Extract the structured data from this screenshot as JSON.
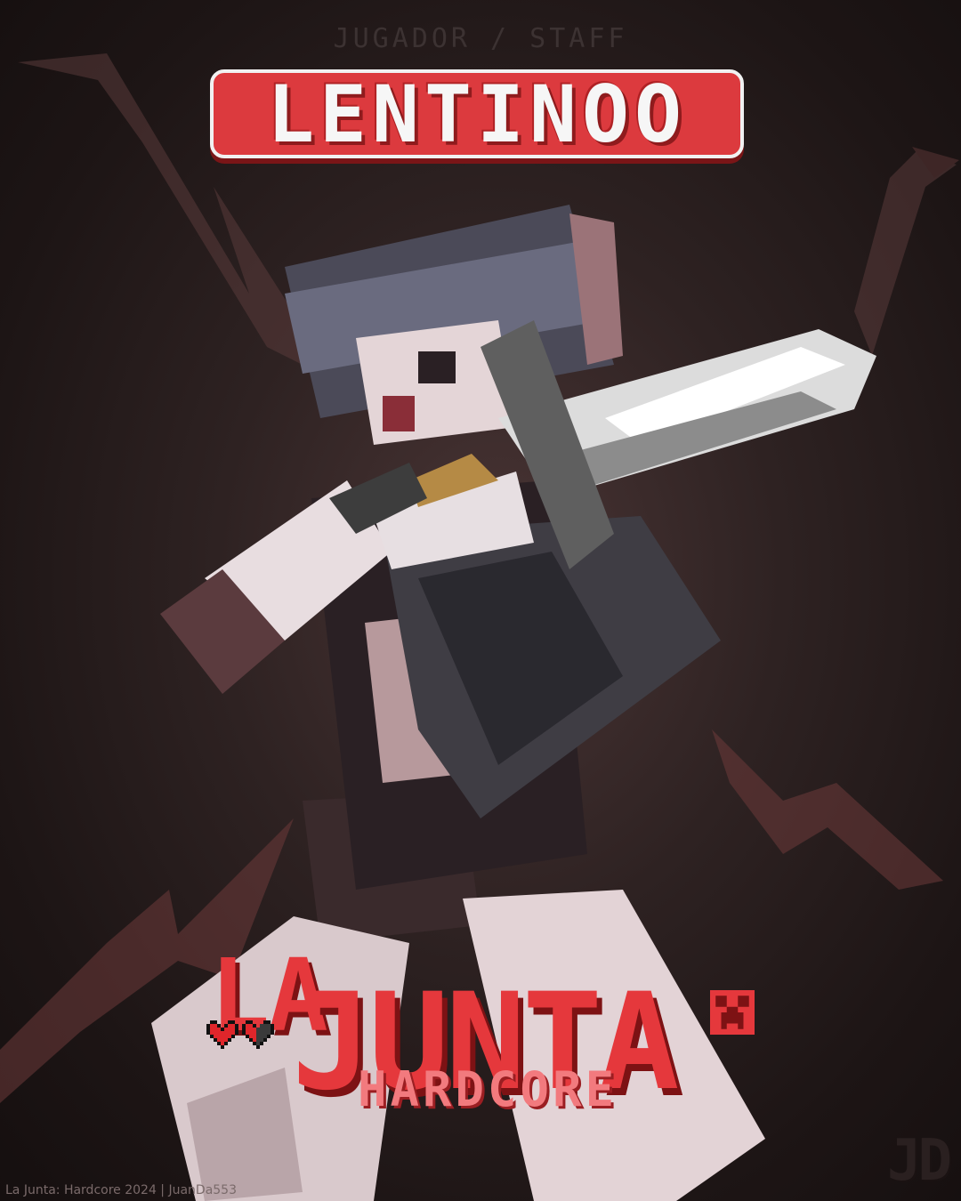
{
  "header": {
    "subtitle": "JUGADOR / STAFF",
    "player_name": "LENTINOO"
  },
  "logo": {
    "word_la": "LA",
    "word_junta": "JUNTA",
    "word_hardcore": "HARDCORE"
  },
  "footer": {
    "credit": "La Junta: Hardcore 2024 | JuanDa553",
    "watermark": "JD"
  },
  "colors": {
    "background": "#2e2222",
    "accent_red": "#dc3a3e",
    "dark_red": "#7d1214",
    "name_text": "#f6f6f6"
  },
  "icons": [
    "lightning-bolt",
    "heart-icon",
    "half-heart-icon",
    "creeper-face-icon",
    "sword"
  ]
}
